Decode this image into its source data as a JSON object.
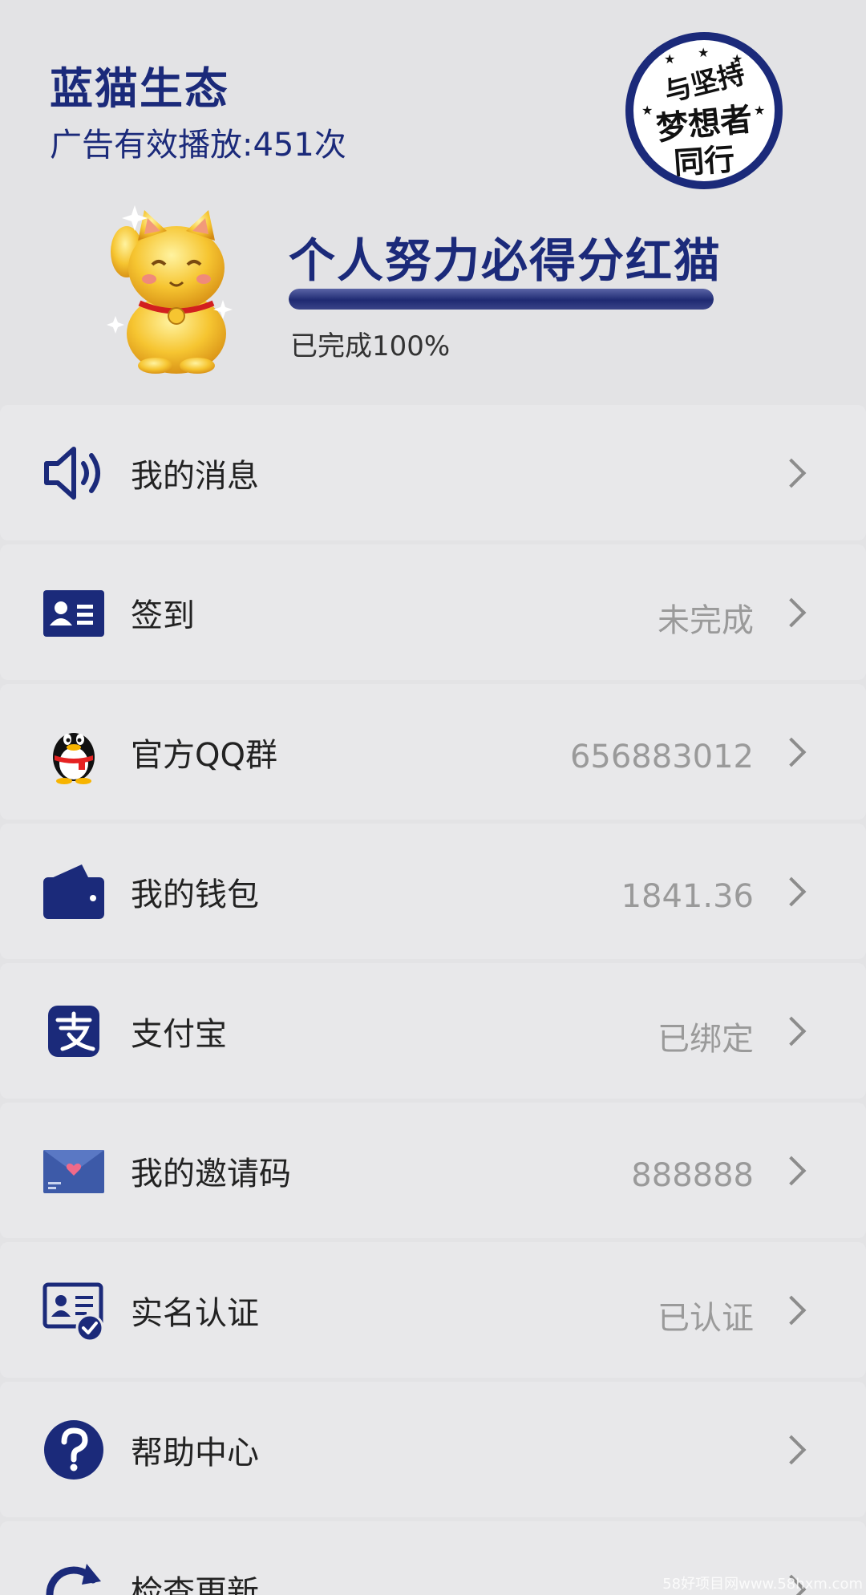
{
  "header": {
    "app_title": "蓝猫生态",
    "ad_count": "广告有效播放:451次",
    "badge_lines": [
      "与坚持",
      "梦想者",
      "同行"
    ],
    "goal_title": "个人努力必得分红猫",
    "progress_fraction": 1.0,
    "progress_text": "已完成100%"
  },
  "menu": {
    "items": [
      {
        "label": "我的消息",
        "value": "",
        "icon": "speaker-icon"
      },
      {
        "label": "签到",
        "value": "未完成",
        "icon": "id-card-icon"
      },
      {
        "label": "官方QQ群",
        "value": "656883012",
        "icon": "qq-penguin-icon"
      },
      {
        "label": "我的钱包",
        "value": "1841.36",
        "icon": "wallet-icon"
      },
      {
        "label": "支付宝",
        "value": "已绑定",
        "icon": "alipay-icon"
      },
      {
        "label": "我的邀请码",
        "value": "888888",
        "icon": "envelope-icon"
      },
      {
        "label": "实名认证",
        "value": "已认证",
        "icon": "verified-id-icon"
      },
      {
        "label": "帮助中心",
        "value": "",
        "icon": "help-icon"
      },
      {
        "label": "检查更新",
        "value": "",
        "icon": "refresh-icon"
      }
    ]
  },
  "watermark": "58好项目网www.58hxm.com",
  "colors": {
    "accent": "#1b2a7a",
    "background": "#e3e3e5",
    "value_text": "#9a9a9a"
  }
}
